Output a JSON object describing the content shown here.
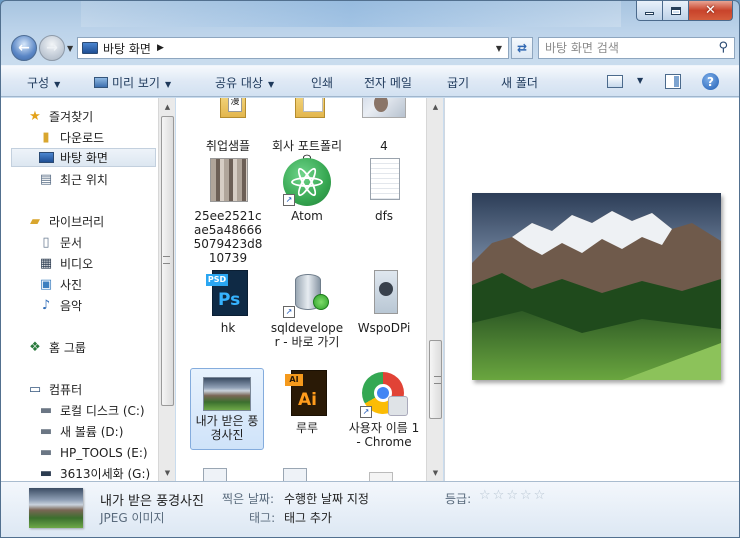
{
  "window": {
    "address_path": "바탕 화면",
    "search_placeholder": "바탕 화면 검색",
    "close_glyph": "✕"
  },
  "toolbar": {
    "organize": "구성",
    "slideshow": "미리 보기",
    "share": "공유 대상",
    "print": "인쇄",
    "email": "전자 메일",
    "burn": "굽기",
    "new_folder": "새 폴더"
  },
  "nav": {
    "favorites": "즐겨찾기",
    "downloads": "다운로드",
    "desktop": "바탕 화면",
    "recent": "최근 위치",
    "libraries": "라이브러리",
    "documents": "문서",
    "videos": "비디오",
    "pictures": "사진",
    "music": "음악",
    "homegroup": "홈 그룹",
    "computer": "컴퓨터",
    "drive_c": "로컬 디스크 (C:)",
    "drive_d": "새 볼륨 (D:)",
    "drive_e": "HP_TOOLS (E:)",
    "drive_g": "3613이세화 (G:)"
  },
  "files": [
    {
      "label": "취업샘플",
      "icon": "folder-icon"
    },
    {
      "label": "회사 포트폴리오",
      "icon": "folder-icon"
    },
    {
      "label": "4",
      "icon": "image-file-icon"
    },
    {
      "label": "25ee2521cae5a486665079423d810739",
      "icon": "image-file-icon"
    },
    {
      "label": "Atom",
      "icon": "atom-app-icon"
    },
    {
      "label": "dfs",
      "icon": "text-file-icon"
    },
    {
      "label": "hk",
      "icon": "photoshop-file-icon"
    },
    {
      "label": "sqldeveloper - 바로 가기",
      "icon": "sqldeveloper-icon"
    },
    {
      "label": "WspoDPi",
      "icon": "image-file-icon"
    },
    {
      "label": "내가 받은 풍경사진",
      "icon": "landscape-image-icon"
    },
    {
      "label": "루루",
      "icon": "illustrator-file-icon"
    },
    {
      "label": "사용자 이름 1 - Chrome",
      "icon": "chrome-icon"
    }
  ],
  "details": {
    "name": "내가 받은 풍경사진",
    "type": "JPEG 이미지",
    "date_key": "찍은 날짜:",
    "date_value": "수행한 날짜 지정",
    "tags_key": "태그:",
    "tags_value": "태그 추가",
    "rating_key": "등급:",
    "rating_value": 0,
    "rating_max": 5
  }
}
